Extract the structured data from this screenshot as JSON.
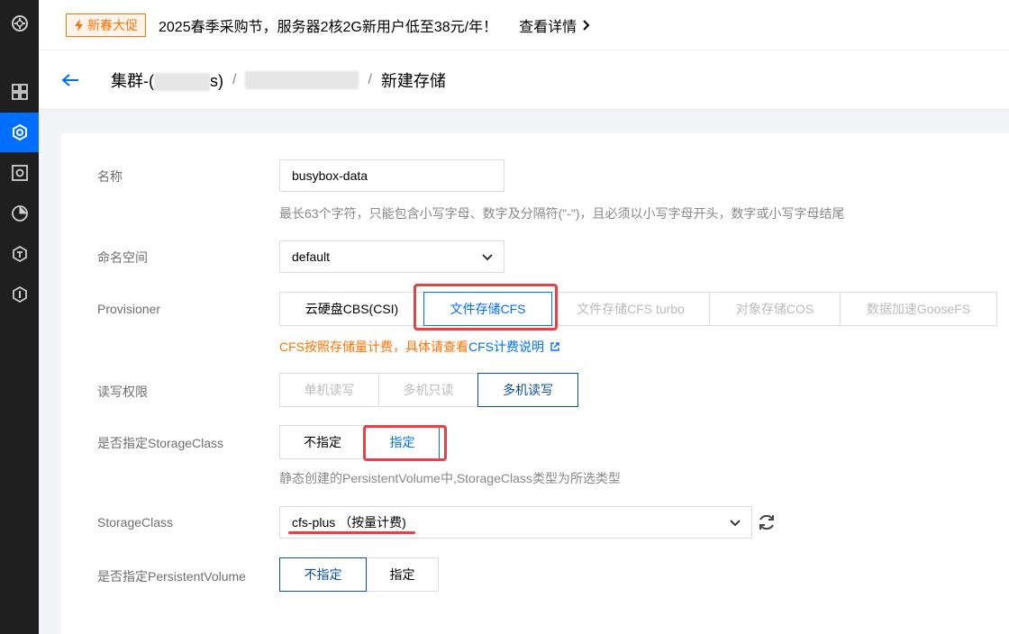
{
  "promo": {
    "tag": "新春大促",
    "message": "2025春季采购节，服务器2核2G新用户低至38元/年！",
    "more": "查看详情"
  },
  "breadcrumb": {
    "cluster_prefix": "集群-(",
    "cluster_suffix": "s)",
    "separator": "/",
    "current": "新建存储"
  },
  "form": {
    "name": {
      "label": "名称",
      "value": "busybox-data",
      "hint": "最长63个字符，只能包含小写字母、数字及分隔符(\"-\")，且必须以小写字母开头，数字或小写字母结尾"
    },
    "namespace": {
      "label": "命名空间",
      "value": "default"
    },
    "provisioner": {
      "label": "Provisioner",
      "options": [
        "云硬盘CBS(CSI)",
        "文件存储CFS",
        "文件存储CFS turbo",
        "对象存储COS",
        "数据加速GooseFS"
      ],
      "selected": "文件存储CFS",
      "billing_note": "CFS按照存储量计费，具体请查看",
      "billing_link": "CFS计费说明"
    },
    "access": {
      "label": "读写权限",
      "options": [
        "单机读写",
        "多机只读",
        "多机读写"
      ],
      "selected": "多机读写"
    },
    "specify_storageclass": {
      "label": "是否指定StorageClass",
      "options": [
        "不指定",
        "指定"
      ],
      "selected": "指定",
      "hint": "静态创建的PersistentVolume中,StorageClass类型为所选类型"
    },
    "storageclass": {
      "label": "StorageClass",
      "value": "cfs-plus （按量计费)"
    },
    "specify_pv": {
      "label": "是否指定PersistentVolume",
      "options": [
        "不指定",
        "指定"
      ],
      "selected": "不指定"
    }
  },
  "colors": {
    "accent": "#006eff",
    "navy": "#0b4ea2",
    "orange": "#ff7200",
    "highlight": "#e94045"
  }
}
